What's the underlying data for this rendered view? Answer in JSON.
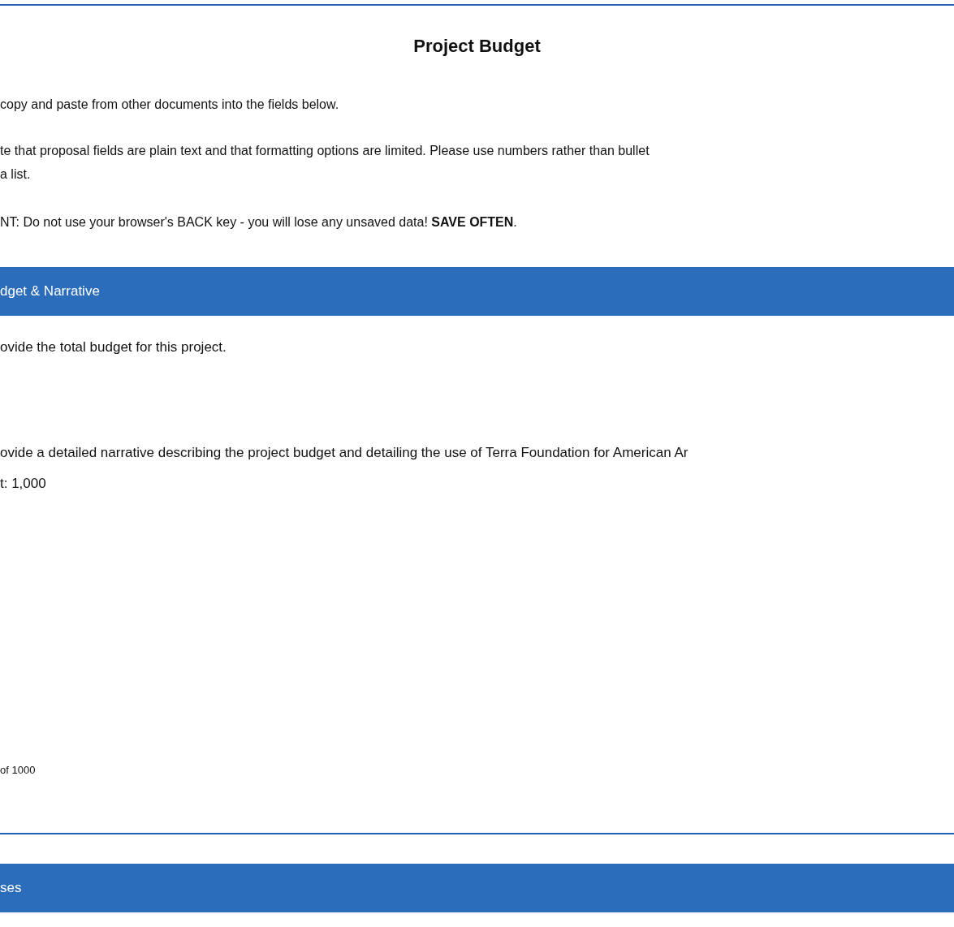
{
  "title": "Project Budget",
  "instructions": [
    {
      "lines": [
        "copy and paste from other documents into the fields below."
      ]
    },
    {
      "lines": [
        "te that proposal fields are plain text and that formatting options are limited. Please use numbers rather than bullet",
        "a list."
      ]
    },
    {
      "lines": [
        "NT: Do not use your browser's BACK key - you will lose any unsaved data! **SAVE OFTEN**."
      ]
    }
  ],
  "sections": [
    {
      "heading": "dget & Narrative",
      "questions": [
        {
          "prompt": "ovide the total budget for this project."
        },
        {
          "prompt": "ovide a detailed narrative describing the project budget and detailing the use of Terra Foundation for American Ar",
          "limit": "t: 1,000",
          "counter": "of 1000"
        }
      ]
    },
    {
      "heading": "ses"
    }
  ]
}
